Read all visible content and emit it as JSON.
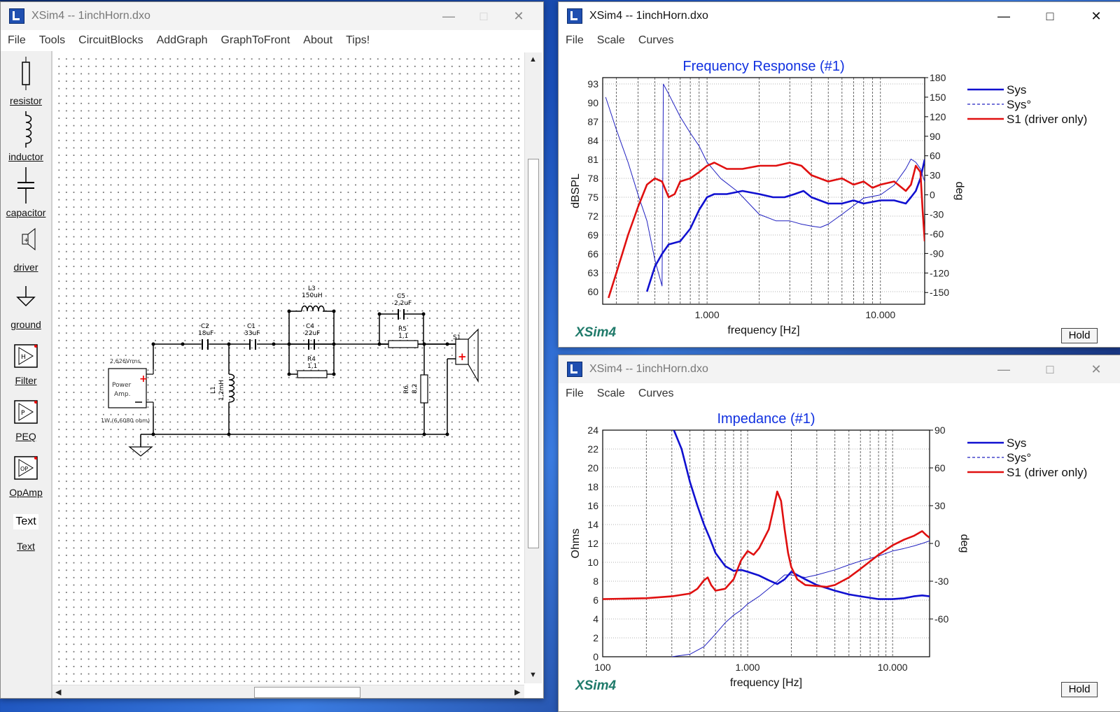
{
  "circuit_window": {
    "title": "XSim4 -- 1inchHorn.dxo",
    "menu": [
      "File",
      "Tools",
      "CircuitBlocks",
      "AddGraph",
      "GraphToFront",
      "About",
      "Tips!"
    ],
    "tools": [
      "resistor",
      "inductor",
      "capacitor",
      "driver",
      "ground",
      "Filter",
      "PEQ",
      "OpAmp",
      "Text"
    ],
    "text_tool_preview": "Text",
    "circuit": {
      "source_voltage": "2,626Vrms",
      "source_label_1": "Power",
      "source_label_2": "Amp.",
      "source_power": "1W (6,6080 ohm)",
      "c2_name": "C2",
      "c2_value": "18uF",
      "c1_name": "C1",
      "c1_value": "33uF",
      "l3_name": "L3",
      "l3_value": "150uH",
      "c4_name": "C4",
      "c4_value": "22uF",
      "r4_name": "R4",
      "r4_value": "1,1",
      "c5_name": "C5",
      "c5_value": "2,2uF",
      "r5_name": "R5",
      "r5_value": "1,1",
      "l1_name": "L1",
      "l1_value": "1,2mH",
      "r6_name": "R6",
      "r6_value": "8,2",
      "s1_name": "S1"
    }
  },
  "freq_window": {
    "title": "XSim4 -- 1inchHorn.dxo",
    "menu": [
      "File",
      "Scale",
      "Curves"
    ],
    "logo": "XSim4",
    "hold": "Hold",
    "chart_data": {
      "type": "line",
      "title": "Frequency Response (#1)",
      "xlabel": "frequency [Hz]",
      "ylabel": "dBSPL",
      "y2label": "deg",
      "xscale": "log",
      "xlim": [
        250,
        18000
      ],
      "ylim": [
        58,
        94
      ],
      "y2lim": [
        -168,
        180
      ],
      "x_tick_labels": [
        "1.000",
        "10.000"
      ],
      "y_tick_labels": [
        "93",
        "90",
        "87",
        "84",
        "81",
        "78",
        "75",
        "72",
        "69",
        "66",
        "63",
        "60"
      ],
      "y2_tick_labels": [
        "180",
        "150",
        "120",
        "90",
        "60",
        "30",
        "0",
        "-30",
        "-60",
        "-90",
        "-120",
        "-150"
      ],
      "legend": [
        "Sys",
        "Sys°",
        "S1 (driver only)"
      ],
      "colors": {
        "sys": "#1010d0",
        "phase": "#2020c0",
        "driver": "#e01010"
      },
      "series": [
        {
          "name": "Sys",
          "axis": "left",
          "x": [
            450,
            500,
            550,
            600,
            700,
            800,
            900,
            1000,
            1100,
            1300,
            1600,
            2000,
            2400,
            2800,
            3200,
            3600,
            4000,
            5000,
            6000,
            7000,
            8000,
            10000,
            12000,
            14000,
            15000,
            16000,
            17000,
            18000
          ],
          "values": [
            60,
            64,
            66,
            67.5,
            68,
            70,
            73,
            75,
            75.5,
            75.5,
            76,
            75.5,
            75,
            75,
            75.5,
            76,
            75,
            74,
            74,
            74.5,
            74,
            74.5,
            74.5,
            74,
            75,
            76,
            78,
            81
          ]
        },
        {
          "name": "Sys°",
          "axis": "right",
          "x": [
            260,
            300,
            350,
            400,
            450,
            500,
            550,
            560,
            600,
            700,
            800,
            900,
            1000,
            1200,
            1500,
            2000,
            2500,
            3000,
            3500,
            4000,
            4500,
            5000,
            6000,
            8000,
            10000,
            12000,
            14000,
            15000,
            16000,
            17000,
            18000
          ],
          "values": [
            150,
            100,
            50,
            0,
            -40,
            -100,
            -140,
            170,
            155,
            120,
            95,
            75,
            50,
            25,
            5,
            -30,
            -40,
            -40,
            -45,
            -48,
            -50,
            -45,
            -30,
            -5,
            0,
            15,
            40,
            55,
            50,
            40,
            20
          ]
        },
        {
          "name": "S1 (driver only)",
          "axis": "left",
          "x": [
            270,
            300,
            350,
            400,
            450,
            500,
            550,
            600,
            650,
            700,
            800,
            900,
            1000,
            1100,
            1300,
            1600,
            2000,
            2500,
            3000,
            3500,
            4000,
            5000,
            6000,
            7000,
            8000,
            9000,
            10000,
            12000,
            14000,
            15000,
            16000,
            17000,
            17500,
            18000
          ],
          "values": [
            59,
            63,
            69,
            73.5,
            77,
            78,
            77.5,
            75,
            75.5,
            77.5,
            78,
            79,
            80,
            80.5,
            79.5,
            79.5,
            80,
            80,
            80.5,
            80,
            78.5,
            77.5,
            78,
            77,
            77.5,
            76.5,
            77,
            77.5,
            76,
            77,
            80,
            79,
            73,
            68
          ]
        }
      ]
    }
  },
  "imp_window": {
    "title": "XSim4 -- 1inchHorn.dxo",
    "menu": [
      "File",
      "Scale",
      "Curves"
    ],
    "logo": "XSim4",
    "hold": "Hold",
    "chart_data": {
      "type": "line",
      "title": "Impedance (#1)",
      "xlabel": "frequency [Hz]",
      "ylabel": "Ohms",
      "y2label": "deg",
      "xscale": "log",
      "xlim": [
        100,
        18000
      ],
      "ylim": [
        0,
        24
      ],
      "y2lim": [
        -90,
        90
      ],
      "x_tick_labels": [
        "100",
        "1.000",
        "10.000"
      ],
      "y_tick_labels": [
        "24",
        "22",
        "20",
        "18",
        "16",
        "14",
        "12",
        "10",
        "8",
        "6",
        "4",
        "2",
        "0"
      ],
      "y2_tick_labels": [
        "90",
        "60",
        "30",
        "0",
        "-30",
        "-60"
      ],
      "legend": [
        "Sys",
        "Sys°",
        "S1 (driver only)"
      ],
      "colors": {
        "sys": "#1010d0",
        "phase": "#2020c0",
        "driver": "#e01010"
      },
      "series": [
        {
          "name": "Sys",
          "axis": "left",
          "x": [
            310,
            350,
            400,
            450,
            500,
            550,
            600,
            700,
            800,
            900,
            1000,
            1200,
            1400,
            1600,
            1800,
            2000,
            2500,
            3000,
            4000,
            5000,
            6000,
            8000,
            10000,
            12000,
            14000,
            16000,
            18000
          ],
          "values": [
            24,
            22,
            18.5,
            16,
            14,
            12.5,
            11,
            9.6,
            9.1,
            9.2,
            9.0,
            8.6,
            8.1,
            7.7,
            8.2,
            9.0,
            8.2,
            7.6,
            7.0,
            6.6,
            6.4,
            6.1,
            6.1,
            6.2,
            6.4,
            6.5,
            6.4
          ]
        },
        {
          "name": "Sys°",
          "axis": "right",
          "x": [
            300,
            400,
            500,
            600,
            700,
            800,
            900,
            1000,
            1200,
            1500,
            1800,
            2000,
            2500,
            3000,
            4000,
            5000,
            6000,
            8000,
            10000,
            12000,
            14000,
            16000,
            18000
          ],
          "values": [
            -90,
            -88,
            -82,
            -72,
            -63,
            -57,
            -53,
            -48,
            -42,
            -33,
            -25,
            -25,
            -27,
            -25,
            -21,
            -17,
            -14,
            -10,
            -6,
            -4,
            -2,
            0,
            2
          ]
        },
        {
          "name": "S1 (driver only)",
          "axis": "left",
          "x": [
            100,
            200,
            300,
            400,
            450,
            500,
            530,
            560,
            600,
            700,
            800,
            900,
            1000,
            1100,
            1200,
            1400,
            1500,
            1600,
            1700,
            1800,
            1900,
            2000,
            2200,
            2500,
            3000,
            3500,
            4000,
            5000,
            6000,
            8000,
            10000,
            12000,
            14000,
            16000,
            17000,
            18000
          ],
          "values": [
            6.1,
            6.2,
            6.4,
            6.7,
            7.2,
            8.1,
            8.4,
            7.6,
            7.0,
            7.2,
            8.2,
            10.2,
            11.2,
            10.8,
            11.5,
            13.5,
            15.5,
            17.5,
            16.5,
            13.5,
            11.0,
            9.5,
            8.2,
            7.6,
            7.5,
            7.4,
            7.6,
            8.4,
            9.3,
            10.8,
            11.8,
            12.4,
            12.8,
            13.3,
            12.9,
            12.6
          ]
        }
      ]
    }
  }
}
